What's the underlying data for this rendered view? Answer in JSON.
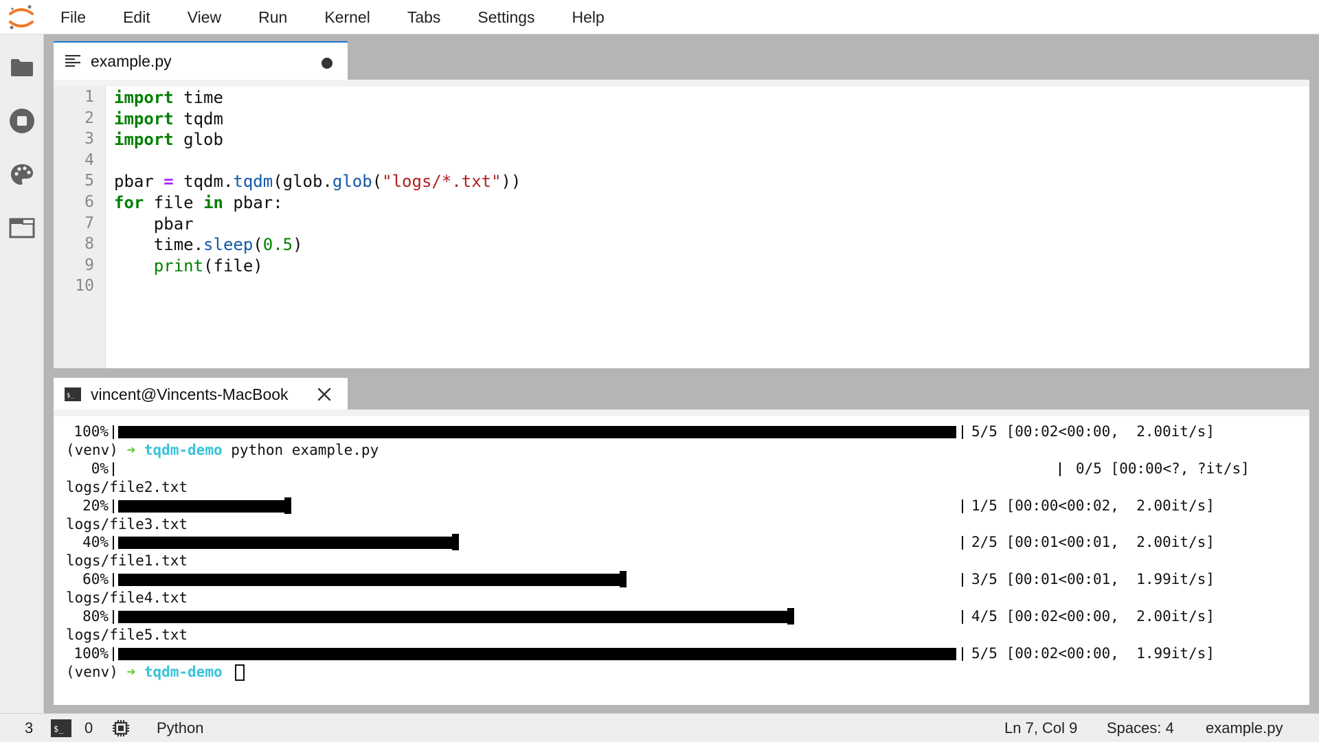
{
  "menubar": {
    "items": [
      "File",
      "Edit",
      "View",
      "Run",
      "Kernel",
      "Tabs",
      "Settings",
      "Help"
    ]
  },
  "sidebar": {
    "icons": [
      "folder-icon",
      "stop-circle-icon",
      "palette-icon",
      "tab-window-icon"
    ]
  },
  "editor": {
    "tab_title": "example.py",
    "line_numbers": [
      "1",
      "2",
      "3",
      "4",
      "5",
      "6",
      "7",
      "8",
      "9",
      "10"
    ],
    "code": [
      {
        "tokens": [
          {
            "t": "import",
            "c": "kw"
          },
          {
            "t": " time",
            "c": ""
          }
        ]
      },
      {
        "tokens": [
          {
            "t": "import",
            "c": "kw"
          },
          {
            "t": " tqdm",
            "c": ""
          }
        ]
      },
      {
        "tokens": [
          {
            "t": "import",
            "c": "kw"
          },
          {
            "t": " glob",
            "c": ""
          }
        ]
      },
      {
        "tokens": []
      },
      {
        "tokens": [
          {
            "t": "pbar ",
            "c": ""
          },
          {
            "t": "=",
            "c": "op"
          },
          {
            "t": " tqdm.",
            "c": ""
          },
          {
            "t": "tqdm",
            "c": "fn"
          },
          {
            "t": "(glob.",
            "c": ""
          },
          {
            "t": "glob",
            "c": "fn"
          },
          {
            "t": "(",
            "c": ""
          },
          {
            "t": "\"logs/*.txt\"",
            "c": "str"
          },
          {
            "t": "))",
            "c": ""
          }
        ]
      },
      {
        "tokens": [
          {
            "t": "for",
            "c": "kw"
          },
          {
            "t": " file ",
            "c": ""
          },
          {
            "t": "in",
            "c": "kw"
          },
          {
            "t": " pbar:",
            "c": ""
          }
        ]
      },
      {
        "tokens": [
          {
            "t": "    pbar",
            "c": ""
          }
        ]
      },
      {
        "tokens": [
          {
            "t": "    time.",
            "c": ""
          },
          {
            "t": "sleep",
            "c": "fn"
          },
          {
            "t": "(",
            "c": ""
          },
          {
            "t": "0.5",
            "c": "num"
          },
          {
            "t": ")",
            "c": ""
          }
        ]
      },
      {
        "tokens": [
          {
            "t": "    ",
            "c": ""
          },
          {
            "t": "print",
            "c": "bi"
          },
          {
            "t": "(file)",
            "c": ""
          }
        ]
      },
      {
        "tokens": []
      }
    ]
  },
  "terminal": {
    "tab_title": "vincent@Vincents-MacBook",
    "lines": [
      {
        "kind": "bar",
        "pct": "100%",
        "fraction": 1.0,
        "stats": "5/5 [00:02<00:00,  2.00it/s]"
      },
      {
        "kind": "prompt",
        "env": "(venv)",
        "arrow": "➜",
        "dir": "tqdm-demo",
        "cmd": "python example.py"
      },
      {
        "kind": "bar",
        "pct": "0%",
        "fraction": 0.0,
        "stats": "0/5 [00:00<?, ?it/s]"
      },
      {
        "kind": "text",
        "text": "logs/file2.txt"
      },
      {
        "kind": "bar",
        "pct": "20%",
        "fraction": 0.2,
        "stats": "1/5 [00:00<00:02,  2.00it/s]"
      },
      {
        "kind": "text",
        "text": "logs/file3.txt"
      },
      {
        "kind": "bar",
        "pct": "40%",
        "fraction": 0.4,
        "stats": "2/5 [00:01<00:01,  2.00it/s]"
      },
      {
        "kind": "text",
        "text": "logs/file1.txt"
      },
      {
        "kind": "bar",
        "pct": "60%",
        "fraction": 0.6,
        "stats": "3/5 [00:01<00:01,  1.99it/s]"
      },
      {
        "kind": "text",
        "text": "logs/file4.txt"
      },
      {
        "kind": "bar",
        "pct": "80%",
        "fraction": 0.8,
        "stats": "4/5 [00:02<00:00,  2.00it/s]"
      },
      {
        "kind": "text",
        "text": "logs/file5.txt"
      },
      {
        "kind": "bar",
        "pct": "100%",
        "fraction": 1.0,
        "stats": "5/5 [00:02<00:00,  1.99it/s]"
      },
      {
        "kind": "prompt",
        "env": "(venv)",
        "arrow": "➜",
        "dir": "tqdm-demo",
        "cmd": "",
        "cursor": true
      }
    ]
  },
  "statusbar": {
    "terminals_count": "3",
    "kernels_count": "0",
    "kernel_name": "Python",
    "cursor_position": "Ln 7, Col 9",
    "indentation": "Spaces: 4",
    "file_name": "example.py"
  },
  "colors": {
    "accent": "#1976d2",
    "logo_orange": "#f37726",
    "keyword_green": "#008000",
    "string_red": "#b21f1f",
    "function_blue": "#1358a8",
    "prompt_green": "#5ccd2a",
    "prompt_cyan": "#38c3d8"
  }
}
